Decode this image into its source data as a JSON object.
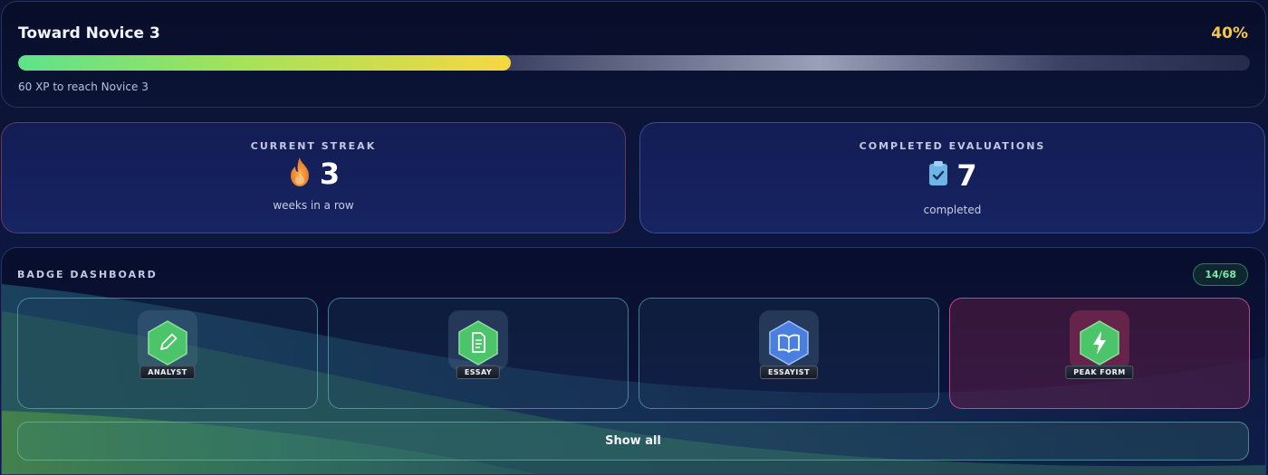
{
  "progress": {
    "title": "Toward Novice 3",
    "percent_label": "40%",
    "percent": 40,
    "subtitle": "60 XP to reach Novice 3"
  },
  "streak": {
    "label": "CURRENT STREAK",
    "value": "3",
    "caption": "weeks in a row",
    "icon": "flame-icon"
  },
  "evaluations": {
    "label": "COMPLETED EVALUATIONS",
    "value": "7",
    "caption": "completed",
    "icon": "clipboard-check-icon"
  },
  "dashboard": {
    "title": "BADGE DASHBOARD",
    "count": "14/68",
    "badges": [
      {
        "label": "ANALYST",
        "icon": "pencil-icon",
        "color": "#4cc46a"
      },
      {
        "label": "ESSAY",
        "icon": "document-icon",
        "color": "#4cc46a"
      },
      {
        "label": "ESSAYIST",
        "icon": "book-icon",
        "color": "#4a7fe0"
      },
      {
        "label": "PEAK FORM",
        "icon": "lightning-icon",
        "color": "#4cc46a"
      }
    ],
    "show_all_label": "Show all"
  },
  "colors": {
    "accent_yellow": "#f2c84a",
    "progress_green": "#5ee38a",
    "badge_count": "#7ee8a8",
    "streak_flame": "#f08a2a"
  }
}
